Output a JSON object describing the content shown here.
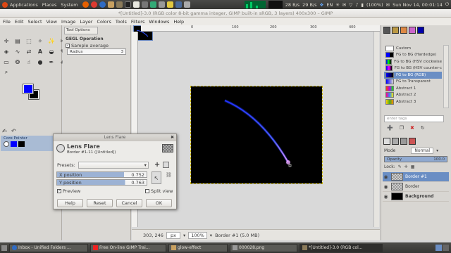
{
  "topbar": {
    "menus": [
      "Applications",
      "Places",
      "System"
    ],
    "network_speed": "28 B/s",
    "network_speed2": "29 B/s",
    "keyboard_layout": "EN",
    "battery": "(100%)",
    "clock": "Sun Nov 14, 00:01:14"
  },
  "window_title": "*[Untitled]-3.0 (RGB color 8-bit gamma integer, GIMP built-in sRGB, 3 layers) 400x300 – GIMP",
  "menubar": [
    "File",
    "Edit",
    "Select",
    "View",
    "Image",
    "Layer",
    "Colors",
    "Tools",
    "Filters",
    "Windows",
    "Help"
  ],
  "tool_options": {
    "tab": "Tool Options",
    "section": "GEGL Operation",
    "sample_average_label": "Sample average",
    "radius_label": "Radius",
    "radius_value": "3"
  },
  "core_pointer": {
    "label": "Core Pointer"
  },
  "colors": {
    "fg": "#0000ff",
    "bg": "#000000"
  },
  "canvas": {
    "bg_color": "#000000",
    "stroke_color": "#4050ff",
    "glow_color": "#c060ff",
    "ruler_ticks": [
      "0",
      "100",
      "200",
      "300",
      "400"
    ]
  },
  "dialog": {
    "title": "Lens Flare",
    "heading": "Lens Flare",
    "subtitle": "Border #1-11 ([Untitled])",
    "presets_label": "Presets:",
    "x_label": "X position",
    "x_value": "0.752",
    "y_label": "Y position",
    "y_value": "0.763",
    "preview_label": "Preview",
    "split_view_label": "Split view",
    "help_button": "Help",
    "reset_button": "Reset",
    "cancel_button": "Cancel",
    "ok_button": "OK"
  },
  "status": {
    "coords": "303, 246",
    "units": "px",
    "zoom": "100%",
    "layer_info": "Border #1 (5.0 MB)"
  },
  "gradients": {
    "items": [
      {
        "name": "Custom",
        "color": "#ffffff"
      },
      {
        "name": "FG to BG (Hardedge)",
        "color": "#0000aa"
      },
      {
        "name": "FG to BG (HSV clockwise",
        "color": "#2040ff"
      },
      {
        "name": "FG to BG (HSV counter-c",
        "color": "#40a0ff"
      },
      {
        "name": "FG to BG (RGB)",
        "color": "#0000cc"
      },
      {
        "name": "FG to Transparent",
        "color": "#3050ff"
      },
      {
        "name": "Abstract 1",
        "color": "#d05030"
      },
      {
        "name": "Abstract 2",
        "color": "#a04080"
      },
      {
        "name": "Abstract 3",
        "color": "#ffc040"
      }
    ],
    "filter_placeholder": "enter tags"
  },
  "layers": {
    "mode_label": "Mode",
    "mode_value": "Normal",
    "opacity_label": "Opacity",
    "opacity_value": "100.0",
    "lock_label": "Lock:",
    "items": [
      {
        "name": "Border #1",
        "thumb": "#777777"
      },
      {
        "name": "Border",
        "thumb": "#888888"
      },
      {
        "name": "Background",
        "thumb": "#000000"
      }
    ]
  },
  "taskbar": {
    "items": [
      "Inbox - Unified Folders ...",
      "Free On-line GIMP Trai...",
      "glow-effect",
      "000028.png",
      "*[Untitled]-3.0 (RGB col..."
    ]
  }
}
